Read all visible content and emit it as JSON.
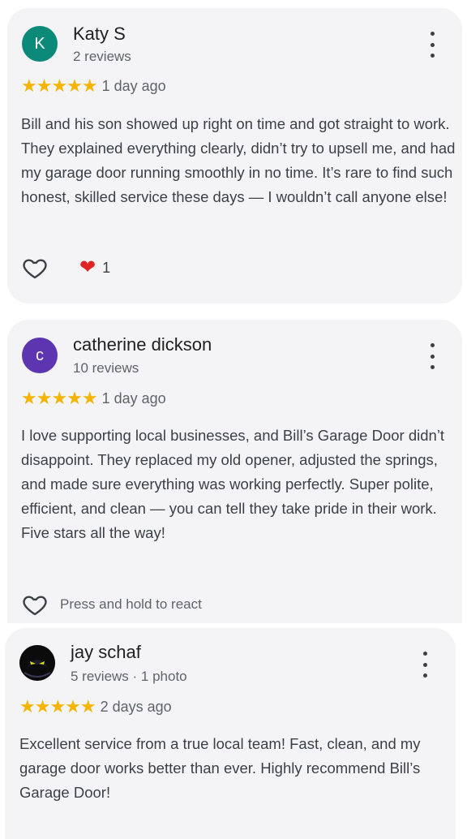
{
  "reviews": [
    {
      "avatar_letter": "K",
      "avatar_color": "#0b8a7a",
      "name": "Katy S",
      "meta": "2 reviews",
      "stars": "★★★★★",
      "date": "1 day ago",
      "text": "Bill and his son showed up right on time and got straight to work. They explained everything clearly, didn’t try to upsell me, and had my garage door running smoothly in no time. It’s rare to find such honest, skilled service these days — I wouldn’t call anyone else!",
      "reaction_count": "1"
    },
    {
      "avatar_letter": "c",
      "avatar_color": "#5e35b1",
      "name": "catherine dickson",
      "meta": "10 reviews",
      "stars": "★★★★★",
      "date": "1 day ago",
      "text": "I love supporting local businesses, and Bill’s Garage Door didn’t disappoint. They replaced my old opener, adjusted the springs, and made sure everything was working perfectly. Super polite, efficient, and clean — you can tell they take pride in their work. Five stars all the way!",
      "react_label": "Press and hold to react"
    },
    {
      "name": "jay schaf",
      "meta": "5 reviews · 1 photo",
      "stars": "★★★★★",
      "date": "2 days ago",
      "text": "Excellent service from a true local team! Fast, clean, and my garage door works better than ever. Highly recommend Bill’s Garage Door!"
    }
  ],
  "colors": {
    "star": "#f5b400",
    "card_bg": "#f4f4f6",
    "heart_red": "#e02424"
  }
}
